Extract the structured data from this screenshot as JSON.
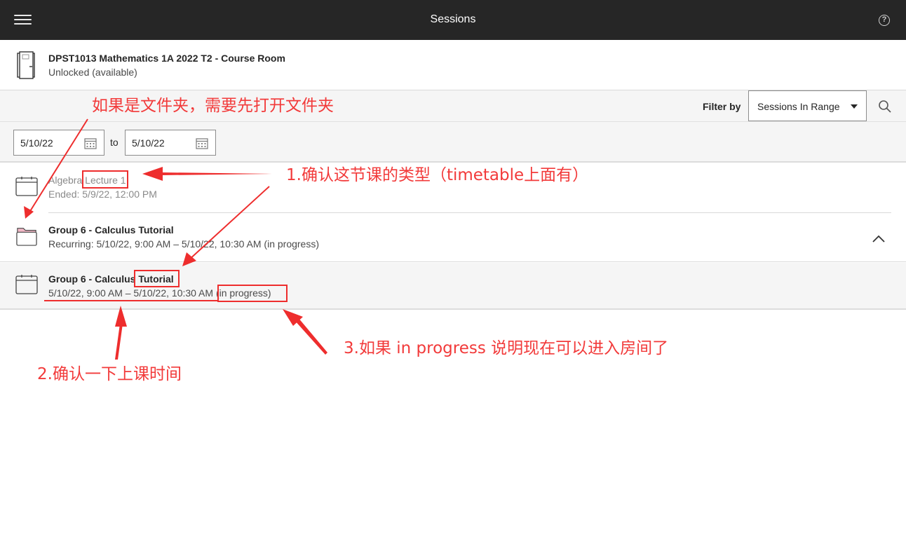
{
  "topbar": {
    "title": "Sessions",
    "help_symbol": "?"
  },
  "course": {
    "title": "DPST1013 Mathematics 1A 2022 T2 - Course Room",
    "status": "Unlocked (available)"
  },
  "filter": {
    "label": "Filter by",
    "selected": "Sessions In Range"
  },
  "dates": {
    "from": "5/10/22",
    "to_label": "to",
    "to": "5/10/22"
  },
  "sessions": [
    {
      "title_prefix": "Algebra ",
      "title_highlight": "Lecture 1",
      "subtitle": "Ended: 5/9/22, 12:00 PM",
      "icon": "calendar-icon"
    },
    {
      "title": "Group 6 - Calculus Tutorial",
      "subtitle": "Recurring: 5/10/22, 9:00 AM – 5/10/22, 10:30 AM (in progress)",
      "icon": "folder-icon"
    },
    {
      "title_prefix": "Group 6 - Calculus ",
      "title_highlight": "Tutorial",
      "subtitle_time": "5/10/22, 9:00 AM – 5/10/22, 10:30 AM ",
      "subtitle_status": "(in progress)",
      "icon": "calendar-icon"
    }
  ],
  "annotations": {
    "folder_note": "如果是文件夹，需要先打开文件夹",
    "step1": "1.确认这节课的类型（timetable上面有）",
    "step2": "2.确认一下上课时间",
    "step3": "3.如果 in progress 说明现在可以进入房间了"
  },
  "colors": {
    "topbar": "#262626",
    "annotation": "#ee2d2d",
    "panel": "#f5f5f5",
    "folder_tab": "#f2b8c6"
  }
}
